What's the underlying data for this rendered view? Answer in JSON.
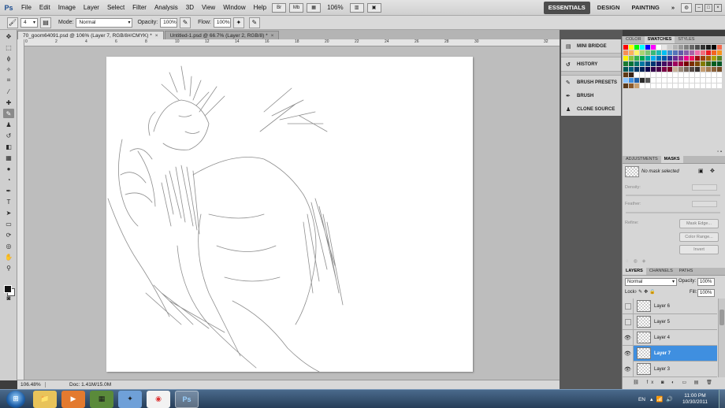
{
  "app": {
    "logo": "Ps"
  },
  "menu": [
    "File",
    "Edit",
    "Image",
    "Layer",
    "Select",
    "Filter",
    "Analysis",
    "3D",
    "View",
    "Window",
    "Help"
  ],
  "menubar": {
    "br_icon": "Br",
    "mb_icon": "Mb",
    "zoom": "106%"
  },
  "workspaces": {
    "essentials": "ESSENTIALS",
    "design": "DESIGN",
    "painting": "PAINTING",
    "more": "»"
  },
  "options": {
    "brush_size": "4",
    "mode_label": "Mode:",
    "mode_value": "Normal",
    "opacity_label": "Opacity:",
    "opacity_value": "100%",
    "flow_label": "Flow:",
    "flow_value": "100%"
  },
  "tabs": [
    {
      "label": "70_goom64091.psd @ 106% (Layer 7, RGB/8#/CMYK) *",
      "close": "×"
    },
    {
      "label": "Untitled-1.psd @ 66.7% (Layer 2, RGB/8) *",
      "close": "×"
    }
  ],
  "ruler_ticks": [
    "0",
    "2",
    "4",
    "6",
    "8",
    "10",
    "12",
    "14",
    "16",
    "18",
    "20",
    "22",
    "24",
    "26",
    "28",
    "30",
    "32"
  ],
  "status": {
    "zoom": "106.48%",
    "doc": "Doc: 1.41M/15.0M"
  },
  "dock": {
    "mini_bridge": "MINI BRIDGE",
    "history": "HISTORY",
    "brush_presets": "BRUSH PRESETS",
    "brush": "BRUSH",
    "clone_source": "CLONE SOURCE"
  },
  "swatches_panel": {
    "tabs": [
      "COLOR",
      "SWATCHES",
      "STYLES"
    ]
  },
  "masks_panel": {
    "tabs": [
      "ADJUSTMENTS",
      "MASKS"
    ],
    "no_mask": "No mask selected",
    "density": "Density:",
    "feather": "Feather:",
    "refine": "Refine:",
    "mask_edge": "Mask Edge...",
    "color_range": "Color Range...",
    "invert": "Invert"
  },
  "layers_panel": {
    "tabs": [
      "LAYERS",
      "CHANNELS",
      "PATHS"
    ],
    "blend_mode": "Normal",
    "opacity_label": "Opacity:",
    "opacity_value": "100%",
    "lock_label": "Lock:",
    "fill_label": "Fill:",
    "fill_value": "100%",
    "layers": [
      {
        "name": "Layer 6",
        "visible": false,
        "selected": false
      },
      {
        "name": "Layer 5",
        "visible": false,
        "selected": false
      },
      {
        "name": "Layer 4",
        "visible": true,
        "selected": false
      },
      {
        "name": "Layer 7",
        "visible": true,
        "selected": true
      },
      {
        "name": "Layer 3",
        "visible": true,
        "selected": false
      }
    ]
  },
  "taskbar": {
    "lang": "EN",
    "time": "11:00 PM",
    "date": "10/30/2011",
    "ps_label": "Ps"
  },
  "colors": {
    "accent": "#3f8fe0",
    "canvas": "#ffffff",
    "workspace": "#bdbdbd"
  }
}
